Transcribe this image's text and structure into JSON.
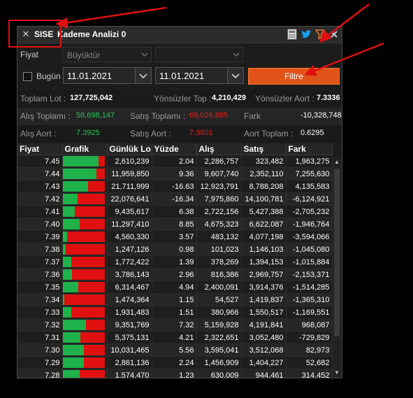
{
  "window": {
    "symbol": "SISE",
    "title": "Kademe Analizi 0",
    "close_glyph": "✕",
    "icons": [
      "calculator-icon",
      "twitter-icon",
      "filter-icon",
      "close-icon"
    ]
  },
  "filters": {
    "fiyat_label": "Fiyat",
    "fiyat_operator": "Büyüktür",
    "fiyat_value": "",
    "bugun_label": "Bugün",
    "date_from": "11.01.2021",
    "date_to": "11.01.2021",
    "filtre_label": "Filtre"
  },
  "summary": {
    "toplam_lot_label": "Toplam Lot :",
    "toplam_lot": "127,725,042",
    "yonsuzler_top_label": "Yönsüzler Top :",
    "yonsuzler_top": "4,210,429",
    "yonsuzler_aort_label": "Yönsüzler Aort :",
    "yonsuzler_aort": "7.3336",
    "alis_toplami_label": "Alış Toplamı :",
    "alis_toplami": "58,698,147",
    "satis_toplami_label": "Satış Toplamı :",
    "satis_toplami": "69,026,895",
    "fark_label": "Fark",
    "fark": "-10,328,748",
    "alis_aort_label": "Alış Aort :",
    "alis_aort": "7.3925",
    "satis_aort_label": "Satış Aort :",
    "satis_aort": "7.3801",
    "aort_toplam_label": "Aort Toplam :",
    "aort_toplam": "0.6295"
  },
  "table": {
    "columns": [
      "Fiyat",
      "Grafik",
      "Günlük Lo",
      "Yüzde",
      "Alış",
      "Satış",
      "Fark"
    ],
    "rows": [
      {
        "fiyat": "7.45",
        "green": 0.86,
        "lot": "2,610,239",
        "yuzde": "2.04",
        "alis": "2,286,757",
        "satis": "323,482",
        "fark": "1,963,275"
      },
      {
        "fiyat": "7.44",
        "green": 0.8,
        "lot": "11,959,850",
        "yuzde": "9.36",
        "alis": "9,607,740",
        "satis": "2,352,110",
        "fark": "7,255,630"
      },
      {
        "fiyat": "7.43",
        "green": 0.6,
        "lot": "21,711,999",
        "yuzde": "-16.63",
        "alis": "12,923,791",
        "satis": "8,788,208",
        "fark": "4,135,583"
      },
      {
        "fiyat": "7.42",
        "green": 0.36,
        "lot": "22,076,641",
        "yuzde": "-16.34",
        "alis": "7,975,860",
        "satis": "14,100,781",
        "fark": "-6,124,921"
      },
      {
        "fiyat": "7.41",
        "green": 0.29,
        "lot": "9,435,617",
        "yuzde": "6.38",
        "alis": "2,722,156",
        "satis": "5,427,388",
        "fark": "-2,705,232"
      },
      {
        "fiyat": "7.40",
        "green": 0.41,
        "lot": "11,297,410",
        "yuzde": "8.85",
        "alis": "4,675,323",
        "satis": "6,622,087",
        "fark": "-1,946,764"
      },
      {
        "fiyat": "7.39",
        "green": 0.11,
        "lot": "4,560,330",
        "yuzde": "3.57",
        "alis": "483,132",
        "satis": "4,077,198",
        "fark": "-3,594,066"
      },
      {
        "fiyat": "7.38",
        "green": 0.08,
        "lot": "1,247,126",
        "yuzde": "0.98",
        "alis": "101,023",
        "satis": "1,146,103",
        "fark": "-1,045,080"
      },
      {
        "fiyat": "7.37",
        "green": 0.21,
        "lot": "1,772,422",
        "yuzde": "1.39",
        "alis": "378,269",
        "satis": "1,394,153",
        "fark": "-1,015,884"
      },
      {
        "fiyat": "7.36",
        "green": 0.22,
        "lot": "3,786,143",
        "yuzde": "2.96",
        "alis": "816,386",
        "satis": "2,969,757",
        "fark": "-2,153,371"
      },
      {
        "fiyat": "7.35",
        "green": 0.38,
        "lot": "6,314,467",
        "yuzde": "4.94",
        "alis": "2,400,091",
        "satis": "3,914,376",
        "fark": "-1,514,285"
      },
      {
        "fiyat": "7.34",
        "green": 0.04,
        "lot": "1,474,364",
        "yuzde": "1.15",
        "alis": "54,527",
        "satis": "1,419,837",
        "fark": "-1,365,310"
      },
      {
        "fiyat": "7.33",
        "green": 0.2,
        "lot": "1,931,483",
        "yuzde": "1.51",
        "alis": "380,966",
        "satis": "1,550,517",
        "fark": "-1,169,551"
      },
      {
        "fiyat": "7.32",
        "green": 0.55,
        "lot": "9,351,769",
        "yuzde": "7.32",
        "alis": "5,159,928",
        "satis": "4,191,841",
        "fark": "968,087"
      },
      {
        "fiyat": "7.31",
        "green": 0.43,
        "lot": "5,375,131",
        "yuzde": "4.21",
        "alis": "2,322,651",
        "satis": "3,052,480",
        "fark": "-729,829"
      },
      {
        "fiyat": "7.30",
        "green": 0.51,
        "lot": "10,031,465",
        "yuzde": "5.56",
        "alis": "3,595,041",
        "satis": "3,512,068",
        "fark": "82,973"
      },
      {
        "fiyat": "7.29",
        "green": 0.51,
        "lot": "2,861,136",
        "yuzde": "2.24",
        "alis": "1,456,909",
        "satis": "1,404,227",
        "fark": "52,682"
      },
      {
        "fiyat": "7.28",
        "green": 0.4,
        "lot": "1,574,470",
        "yuzde": "1.23",
        "alis": "630,009",
        "satis": "944,461",
        "fark": "314,452"
      }
    ]
  },
  "colors": {
    "accent_orange": "#e0541a",
    "positive_green": "#1fb14a",
    "negative_red": "#e01010",
    "annotation_red": "#e01010"
  }
}
